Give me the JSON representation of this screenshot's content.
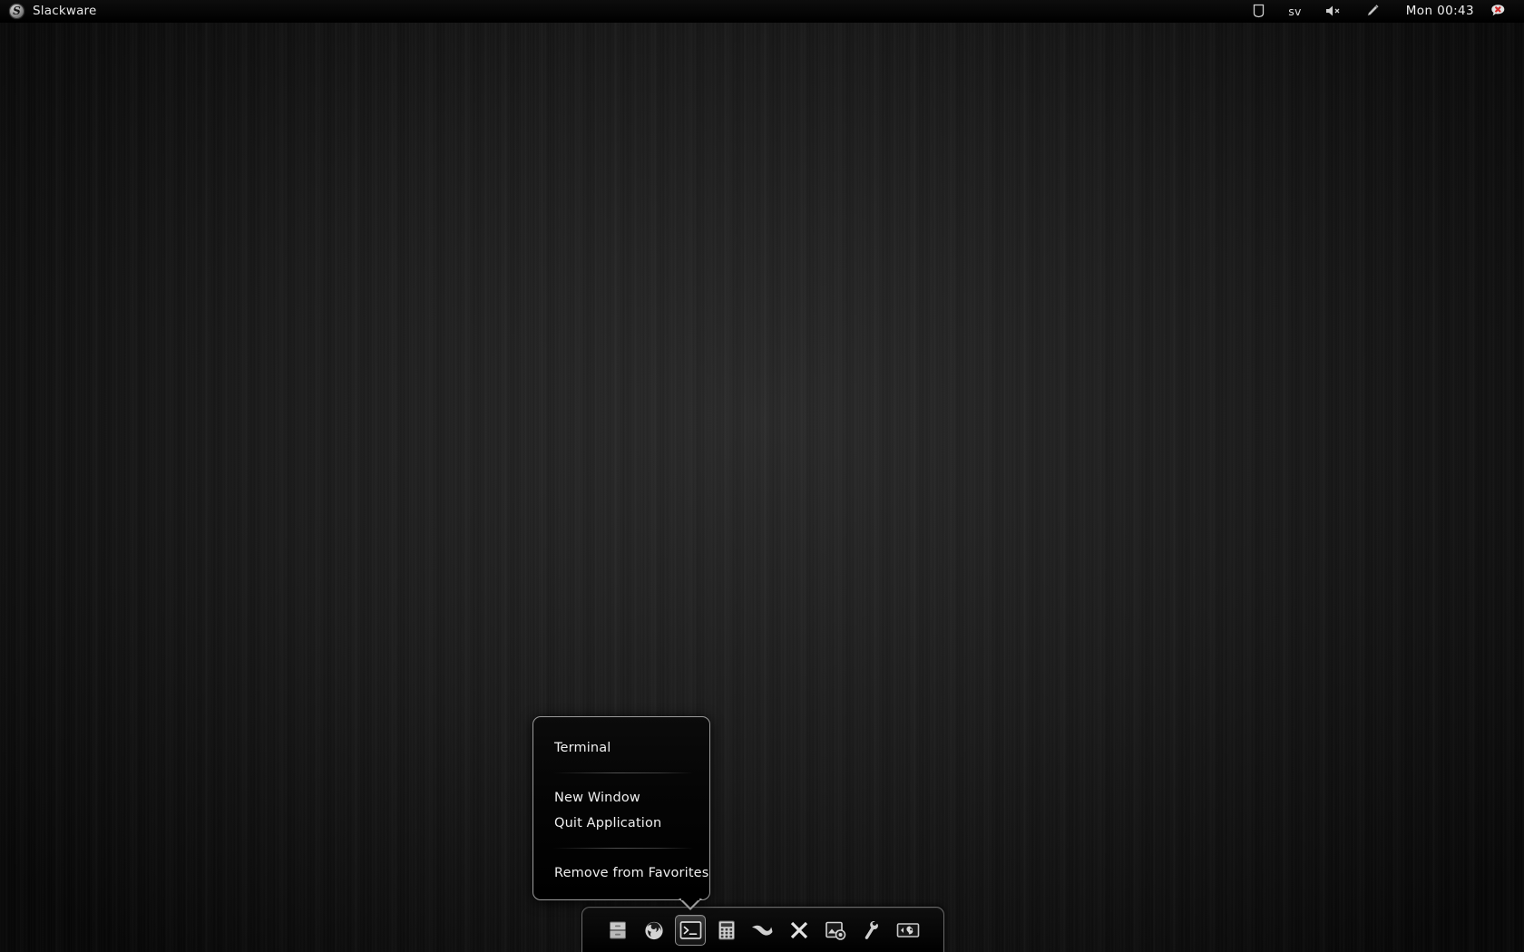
{
  "desktop": {
    "wallpaper_color": "#111111",
    "accent_color": "#9b9b9b"
  },
  "top_panel": {
    "logo_letter": "S",
    "logo_name": "slackware-logo-icon",
    "title": "Slackware",
    "tray": [
      {
        "name": "clipboard-icon",
        "icon": "clipboard",
        "label": ""
      },
      {
        "name": "keyboard-layout-indicator",
        "icon": "text",
        "label": "sv"
      },
      {
        "name": "volume-muted-icon",
        "icon": "speaker-muted",
        "label": ""
      },
      {
        "name": "screenshot-pen-icon",
        "icon": "pen",
        "label": ""
      }
    ],
    "clock": "Mon 00:43",
    "chat_status": {
      "name": "chat-offline-icon",
      "icon": "speech-bubble-x"
    }
  },
  "context_menu": {
    "title": "Terminal",
    "groups": [
      {
        "items": [
          {
            "label": "New Window",
            "name": "menu-item-new-window"
          },
          {
            "label": "Quit Application",
            "name": "menu-item-quit-application"
          }
        ]
      },
      {
        "items": [
          {
            "label": "Remove from Favorites",
            "name": "menu-item-remove-from-favorites"
          }
        ]
      }
    ]
  },
  "dock": {
    "items": [
      {
        "name": "dock-item-file-manager",
        "label": "File Manager",
        "icon": "file-cabinet",
        "active": false
      },
      {
        "name": "dock-item-firefox",
        "label": "Firefox",
        "icon": "firefox",
        "active": false
      },
      {
        "name": "dock-item-terminal",
        "label": "Terminal",
        "icon": "terminal",
        "active": true
      },
      {
        "name": "dock-item-calculator",
        "label": "Calculator",
        "icon": "calculator",
        "active": false
      },
      {
        "name": "dock-item-xfce",
        "label": "Xfce",
        "icon": "mouse-swoosh",
        "active": false
      },
      {
        "name": "dock-item-xterm",
        "label": "XTerm",
        "icon": "letter-x",
        "active": false
      },
      {
        "name": "dock-item-archive-manager",
        "label": "Archive Manager",
        "icon": "disk-clock",
        "active": false
      },
      {
        "name": "dock-item-settings",
        "label": "Settings",
        "icon": "wrench",
        "active": false
      },
      {
        "name": "dock-item-gimp",
        "label": "GIMP",
        "icon": "framed-gimp",
        "active": false
      }
    ]
  }
}
